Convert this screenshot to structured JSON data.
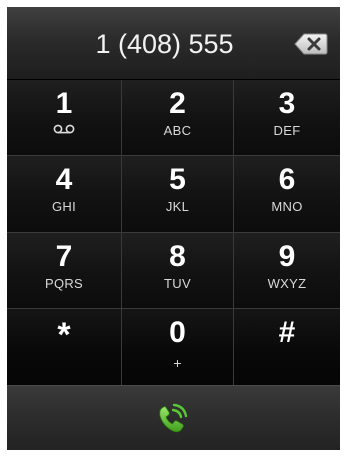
{
  "display": {
    "number": "1 (408) 555",
    "backspace_icon": "backspace-icon"
  },
  "keys": [
    {
      "digit": "1",
      "letters": "",
      "icon": "voicemail-icon"
    },
    {
      "digit": "2",
      "letters": "ABC"
    },
    {
      "digit": "3",
      "letters": "DEF"
    },
    {
      "digit": "4",
      "letters": "GHI"
    },
    {
      "digit": "5",
      "letters": "JKL"
    },
    {
      "digit": "6",
      "letters": "MNO"
    },
    {
      "digit": "7",
      "letters": "PQRS"
    },
    {
      "digit": "8",
      "letters": "TUV"
    },
    {
      "digit": "9",
      "letters": "WXYZ"
    },
    {
      "digit": "*",
      "letters": ""
    },
    {
      "digit": "0",
      "letters": "+"
    },
    {
      "digit": "#",
      "letters": ""
    }
  ],
  "call": {
    "icon": "phone-call-icon",
    "color": "#59c734"
  },
  "colors": {
    "background": "#0b0b0b",
    "display_text": "#f2f2f2",
    "key_text": "#ffffff",
    "call_green": "#59c734"
  }
}
